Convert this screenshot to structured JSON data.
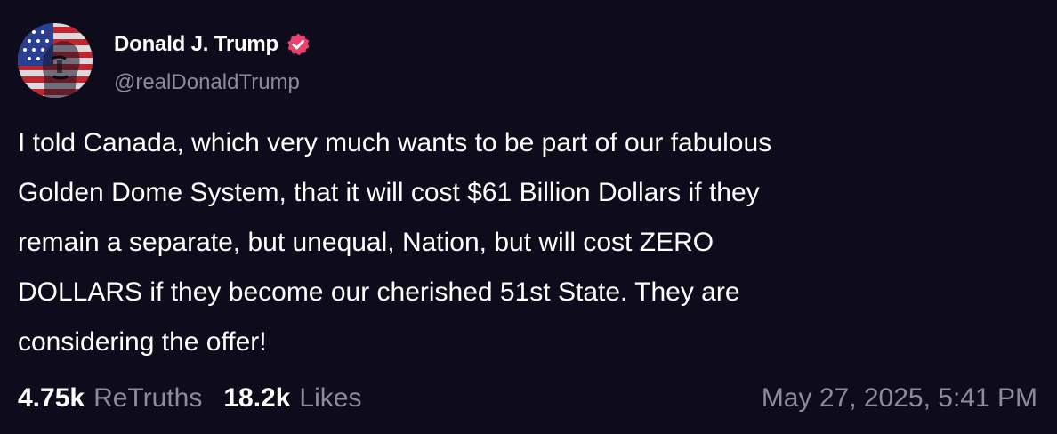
{
  "author": {
    "display_name": "Donald J. Trump",
    "handle": "@realDonaldTrump",
    "verified_icon": "verified-badge-icon",
    "badge_color": "#e8426d"
  },
  "post": {
    "text": "I told Canada, which very much wants to be part of our fabulous\nGolden Dome System, that it will cost $61 Billion Dollars if they\nremain a separate, but unequal, Nation, but will cost ZERO\nDOLLARS if they become our cherished 51st State. They are\nconsidering the offer!"
  },
  "stats": {
    "retruths_count": "4.75k",
    "retruths_label": "ReTruths",
    "likes_count": "18.2k",
    "likes_label": "Likes"
  },
  "timestamp": "May 27, 2025, 5:41 PM",
  "colors": {
    "background": "#0e0b1c",
    "text": "#ffffff",
    "muted": "#8e8b9c"
  }
}
